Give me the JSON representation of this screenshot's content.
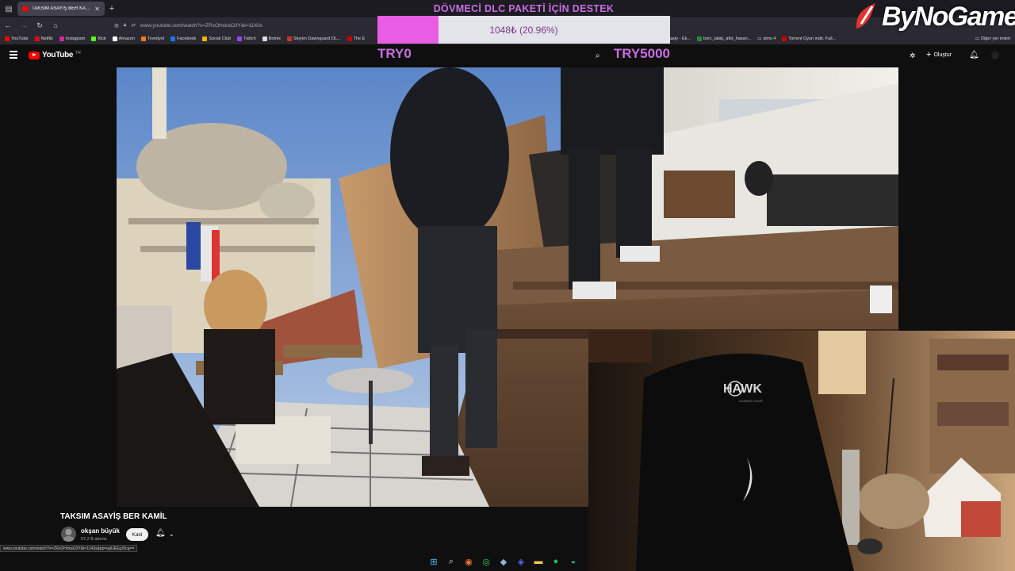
{
  "browser": {
    "tab_title": "TAKSİM ASAYİŞ BER KAMİL - Yo",
    "url": "www.youtube.com/watch?v=ZRsOHckaO3Y&t=1143s",
    "bookmarks": [
      "YouTube",
      "Netflix",
      "Instagram",
      "Kick",
      "Amazon",
      "Trendyol",
      "Facebook",
      "Social Club",
      "Twitch",
      "Botnix",
      "Skyrim Dawnguard DL...",
      "The E"
    ],
    "bookmarks_right": [
      "asty - Ek...",
      "borc_takip_afet_hasan...",
      "sims 4",
      "Torrent Oyun indir, Full..."
    ],
    "other_bookmarks": "Diğer yer imleri"
  },
  "youtube": {
    "logo_text": "YouTube",
    "region": "TR",
    "create_label": "Oluştur"
  },
  "donation": {
    "title": "DÖVMECİ DLC PAKETİ İÇİN DESTEK",
    "amount": "1048₺ (20.96%)",
    "progress": 0.2096,
    "min_label": "TRY0",
    "max_label": "TRY5000"
  },
  "brand": {
    "name": "ByNoGame"
  },
  "video": {
    "title": "TAKSIM ASAYİŞ BER KAMİL",
    "channel": "okşan büyük",
    "subscribers": "57,2 B abone",
    "join_label": "Katıl"
  },
  "webcam": {
    "chair_brand": "HAWK",
    "chair_sub": "GAMING CHAIR"
  },
  "status_url": "www.youtube.com/watch?v=ZRsOHckaO3Y&t=1143s&pp=ugUEEgJ0cg==",
  "colors": {
    "donation_accent": "#c86ee0",
    "donation_fill": "#e85ce6",
    "youtube_red": "#ff0000"
  }
}
